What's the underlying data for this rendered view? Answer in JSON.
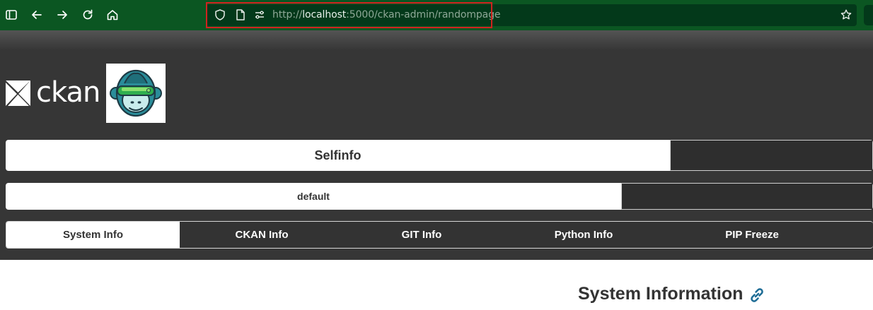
{
  "browser": {
    "url_scheme": "http://",
    "url_host": "localhost",
    "url_rest": ":5000/ckan-admin/randompage",
    "icons": [
      "sidebar-icon",
      "back-icon",
      "forward-icon",
      "reload-icon",
      "home-icon",
      "shield-icon",
      "page-icon",
      "permissions-icon",
      "bookmark-star-icon"
    ],
    "colors": {
      "toolbar": "#0b5622",
      "urlbar": "#03391a",
      "highlight": "#d0231f"
    }
  },
  "site": {
    "logo_text": "ckan",
    "colors": {
      "masthead": "#363636",
      "active": "#ffffff",
      "link_icon": "#1f6d96"
    }
  },
  "nav": {
    "row1_label": "Selfinfo",
    "row2_label": "default",
    "tabs": [
      "System Info",
      "CKAN Info",
      "GIT Info",
      "Python Info",
      "PIP Freeze"
    ],
    "active_tab": "System Info"
  },
  "main": {
    "section_title": "System Information"
  }
}
